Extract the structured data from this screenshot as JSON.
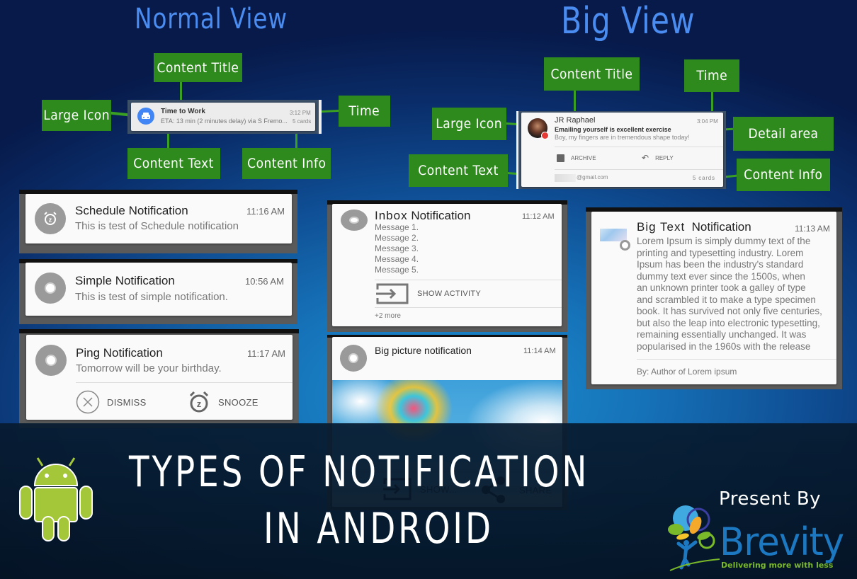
{
  "headings": {
    "normal_view": "Normal View",
    "big_view": "Big View"
  },
  "colors": {
    "callout_green": "#2f8a1e",
    "heading_blue": "#4a8cf0",
    "android_green": "#a4c639",
    "brevity_blue": "#1c78c0",
    "brevity_tagline_green": "#7ab929"
  },
  "normal_view": {
    "callouts": {
      "content_title": "Content Title",
      "large_icon": "Large Icon",
      "time": "Time",
      "content_text": "Content Text",
      "content_info": "Content Info"
    },
    "card": {
      "icon": "car-icon",
      "title": "Time to Work",
      "text": "ETA: 13 min (2 minutes delay) via S Fremo...",
      "time": "3:12 PM",
      "info": "5 cards"
    }
  },
  "big_view": {
    "callouts": {
      "content_title": "Content Title",
      "time": "Time",
      "large_icon": "Large Icon",
      "detail_area": "Detail area",
      "content_text": "Content Text",
      "content_info": "Content Info"
    },
    "card": {
      "icon": "avatar-photo",
      "title": "JR Raphael",
      "detail_bold": "Emailing yourself is excellent exercise",
      "detail_text": "Boy, my fingers are in tremendous shape today!",
      "time": "3:04 PM",
      "actions": [
        {
          "icon": "archive-icon",
          "label": "ARCHIVE"
        },
        {
          "icon": "reply-icon",
          "label": "REPLY"
        }
      ],
      "content_text": "@gmail.com",
      "info": "5 cards"
    }
  },
  "notifications": {
    "schedule": {
      "icon": "alarm-icon",
      "title_a": "Schedule",
      "title_b": "Notification",
      "text": "This is test of Schedule notification",
      "time": "11:16 AM"
    },
    "simple": {
      "icon": "disc-icon",
      "title_a": "Simple",
      "title_b": "Notification",
      "text": "This is test of simple notification.",
      "time": "10:56 AM"
    },
    "ping": {
      "icon": "disc-icon",
      "title": "Ping Notification",
      "text": "Tomorrow will be your birthday.",
      "time": "11:17 AM",
      "actions": [
        {
          "icon": "dismiss-icon",
          "label": "DISMISS"
        },
        {
          "icon": "snooze-icon",
          "label": "SNOOZE"
        }
      ]
    },
    "inbox": {
      "icon": "disc-icon",
      "title_a": "Inbox",
      "title_b": "Notification",
      "time": "11:12 AM",
      "messages": [
        "Message 1.",
        "Message 2.",
        "Message 3.",
        "Message 4.",
        "Message 5."
      ],
      "action": {
        "icon": "show-activity-icon",
        "label": "SHOW ACTIVITY"
      },
      "more": "+2 more"
    },
    "big_picture": {
      "icon": "disc-icon",
      "title": "Big picture notification",
      "time": "11:14 AM",
      "picture": "balloons-in-sky",
      "actions": [
        {
          "icon": "show-activity-icon",
          "label": "SHOW..."
        },
        {
          "icon": "share-icon",
          "label": "SHARE"
        }
      ]
    },
    "big_text": {
      "icon": "thumbnail-image",
      "title_a": "Big Text",
      "title_b": "Notification",
      "time": "11:13 AM",
      "lines": [
        "Lorem Ipsum is simply dummy text of the",
        "printing and typesetting industry. Lorem",
        "Ipsum has been the industry's standard",
        "dummy text ever since the 1500s, when",
        "an unknown printer took a galley of type",
        "and scrambled it to make a type specimen",
        "book. It has survived not only five centuries,",
        "but also the leap into electronic typesetting,",
        "remaining essentially unchanged. It was",
        "popularised in the 1960s with the release"
      ],
      "summary": "By: Author of Lorem ipsum"
    }
  },
  "banner": {
    "title_line1": "TYPES OF NOTIFICATION",
    "title_line2": "IN ANDROID",
    "present_by": "Present By",
    "brand_name": "Brevity",
    "brand_tagline": "Delivering more with less"
  }
}
